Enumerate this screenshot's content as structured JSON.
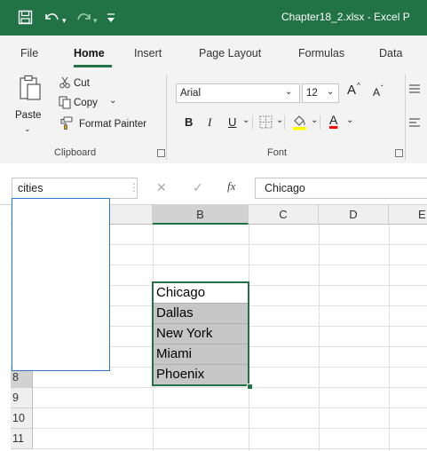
{
  "titlebar": {
    "save_icon": "save-icon",
    "undo_icon": "undo-icon",
    "redo_icon": "redo-icon",
    "customize_icon": "customize-qat-icon",
    "title": "Chapter18_2.xlsx  -  Excel P",
    "bg_color": "#217346"
  },
  "tabs": [
    "File",
    "Home",
    "Insert",
    "Page Layout",
    "Formulas",
    "Data"
  ],
  "active_tab": "Home",
  "ribbon": {
    "clipboard": {
      "paste_label": "Paste",
      "cut_label": "Cut",
      "copy_label": "Copy",
      "format_painter_label": "Format Painter",
      "group_label": "Clipboard"
    },
    "font": {
      "font_name": "Arial",
      "font_size": "12",
      "grow_label": "A",
      "shrink_label": "A",
      "bold": "B",
      "italic": "I",
      "underline": "U",
      "font_color_label": "A",
      "group_label": "Font",
      "fill_color": "#ffff00",
      "font_color": "#ff0000"
    }
  },
  "formula_bar": {
    "name_box_value": "cities",
    "cancel_symbol": "✕",
    "enter_symbol": "✓",
    "fx_label": "fx",
    "formula_value": "Chicago"
  },
  "name_dropdown": {
    "items": []
  },
  "grid": {
    "columns": [
      "B",
      "C",
      "D",
      "E"
    ],
    "rows": [
      "8",
      "9",
      "10",
      "11"
    ],
    "cells": [
      "Chicago",
      "Dallas",
      "New York",
      "Miami",
      "Phoenix"
    ],
    "selection_color": "#217346"
  }
}
